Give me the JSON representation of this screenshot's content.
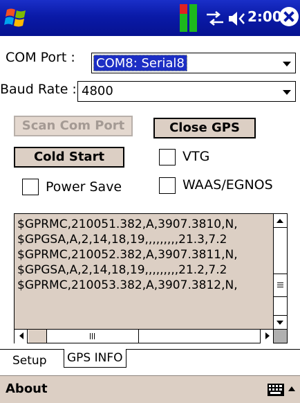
{
  "status_bar": {
    "clock": "2:00",
    "icons": [
      "windows-start-icon",
      "signal-strength-icon",
      "connectivity-icon",
      "volume-icon",
      "close-icon"
    ],
    "colors": {
      "titlebar": "#0a1aa8",
      "signal_green": "#1db81d",
      "signal_red": "#e02020"
    }
  },
  "form": {
    "com_port_label": "COM Port :",
    "com_port_value": "COM8:  Serial8",
    "baud_rate_label": "Baud Rate :",
    "baud_rate_value": "4800"
  },
  "buttons": {
    "scan_com_port": "Scan Com Port",
    "close_gps": "Close GPS",
    "cold_start": "Cold Start"
  },
  "checkboxes": {
    "vtg": "VTG",
    "power_save": "Power Save",
    "waas_egnos": "WAAS/EGNOS"
  },
  "log": {
    "lines": [
      "$GPRMC,210051.382,A,3907.3810,N,",
      "$GPGSA,A,2,14,18,19,,,,,,,,,21.3,7.2",
      "$GPRMC,210052.382,A,3907.3811,N,",
      "$GPGSA,A,2,14,18,19,,,,,,,,,21.2,7.2",
      "$GPRMC,210053.382,A,3907.3812,N,"
    ]
  },
  "tabs": {
    "setup": "Setup",
    "gps_info": "GPS INFO"
  },
  "menubar": {
    "about": "About"
  }
}
